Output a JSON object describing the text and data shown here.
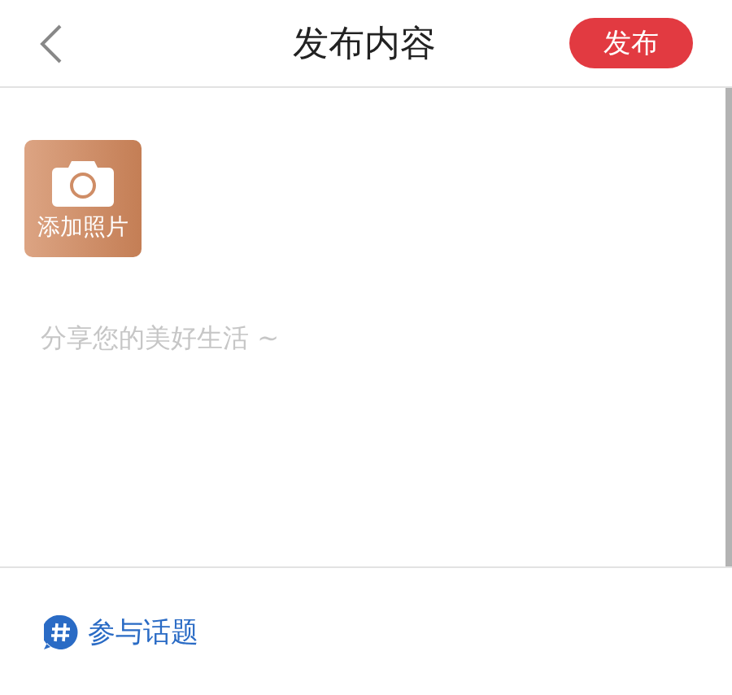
{
  "header": {
    "title": "发布内容",
    "publish_button": "发布"
  },
  "add_photo": {
    "label": "添加照片"
  },
  "content": {
    "placeholder": "分享您的美好生活 ~"
  },
  "topic": {
    "label": "参与话题"
  }
}
